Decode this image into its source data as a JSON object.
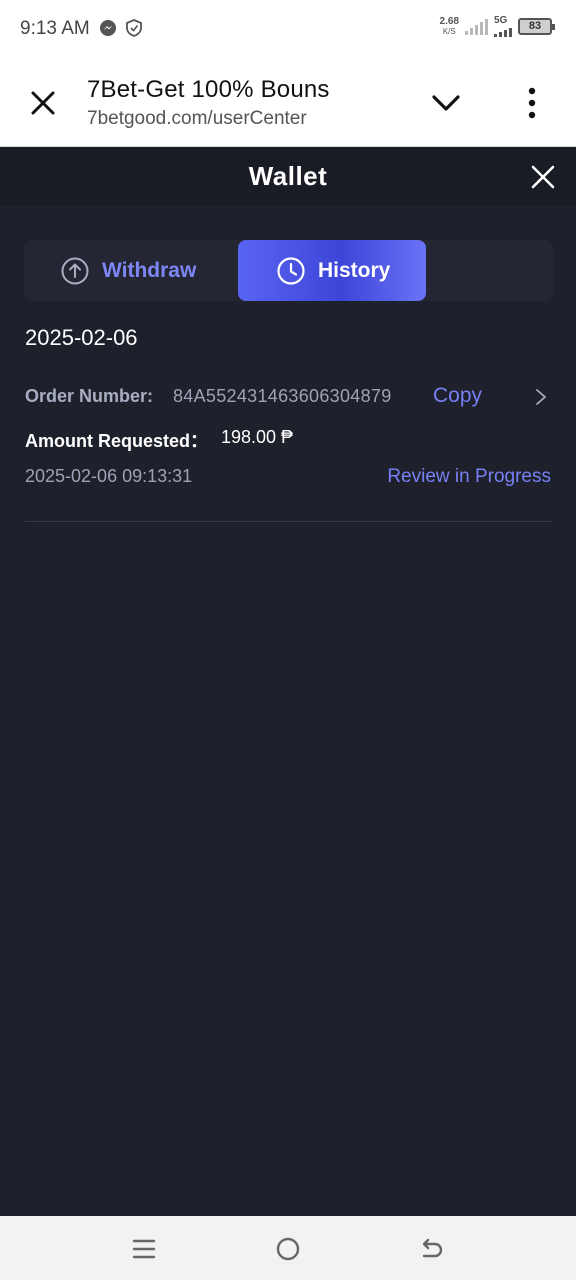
{
  "status_bar": {
    "time": "9:13 AM",
    "net_speed": "2.68",
    "net_unit": "K/S",
    "network": "5G",
    "battery": "83",
    "icons": [
      "messenger-icon",
      "shield-icon",
      "signal-icon",
      "battery-icon"
    ]
  },
  "browser": {
    "title": "7Bet-Get 100% Bouns",
    "url": "7betgood.com/userCenter",
    "icons": [
      "close-icon",
      "chevron-down-icon",
      "more-vertical-icon"
    ]
  },
  "wallet": {
    "title": "Wallet",
    "tabs": [
      {
        "label": "Withdraw",
        "icon": "arrow-up-circle-icon",
        "active": false
      },
      {
        "label": "History",
        "icon": "clock-icon",
        "active": true
      }
    ],
    "accent_color": "#5a64f3"
  },
  "history": {
    "date": "2025-02-06",
    "entries": [
      {
        "order_label": "Order Number:",
        "order_number": "84A552431463606304879",
        "copy_label": "Copy",
        "amount_label": "Amount Requested：",
        "amount": "198.00 ₱",
        "timestamp": "2025-02-06 09:13:31",
        "status": "Review in Progress"
      }
    ]
  },
  "nav_bar": {
    "icons": [
      "menu-icon",
      "home-icon",
      "back-icon"
    ]
  }
}
